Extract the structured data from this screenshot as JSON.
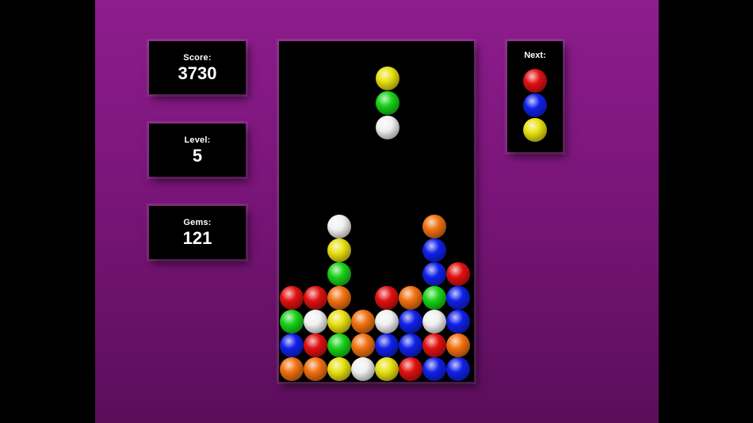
{
  "hud": {
    "score_label": "Score:",
    "score_value": "3730",
    "level_label": "Level:",
    "level_value": "5",
    "gems_label": "Gems:",
    "gems_value": "121",
    "next_label": "Next:"
  },
  "colors": {
    "red": "#e01010",
    "blue": "#1020e8",
    "yellow": "#e8e010",
    "green": "#18d018",
    "white": "#f0f0f0",
    "orange": "#f07010",
    "stage_bg": "#7f187f",
    "panel_bg": "#000000"
  },
  "next_piece": [
    "red",
    "blue",
    "yellow"
  ],
  "falling_piece": {
    "column": 4,
    "row_top": 0,
    "gems": [
      "yellow",
      "green",
      "white"
    ]
  },
  "board": {
    "columns": 8,
    "rows": 14,
    "stacks": [
      [
        "orange",
        "blue",
        "green",
        "red"
      ],
      [
        "orange",
        "red",
        "white",
        "red"
      ],
      [
        "yellow",
        "green",
        "yellow",
        "orange",
        "green",
        "yellow",
        "white"
      ],
      [
        "white",
        "orange",
        "orange"
      ],
      [
        "yellow",
        "blue",
        "white",
        "red"
      ],
      [
        "red",
        "blue",
        "blue",
        "orange"
      ],
      [
        "blue",
        "red",
        "white",
        "green",
        "blue",
        "blue",
        "orange"
      ],
      [
        "blue",
        "orange",
        "blue",
        "blue",
        "red"
      ]
    ]
  }
}
